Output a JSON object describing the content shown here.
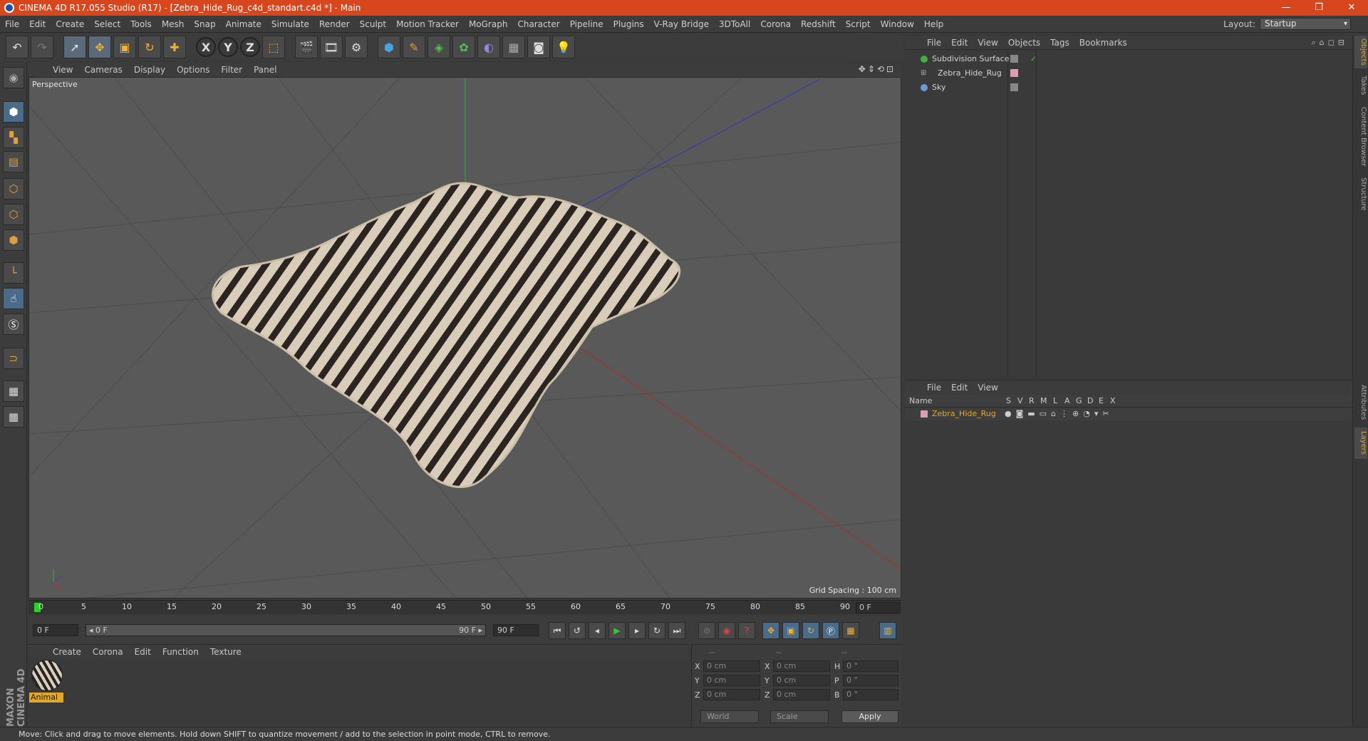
{
  "window": {
    "title": "CINEMA 4D R17.055 Studio (R17) - [Zebra_Hide_Rug_c4d_standart.c4d *] - Main",
    "controls": [
      "—",
      "❐",
      "✕"
    ]
  },
  "menubar": {
    "items": [
      "File",
      "Edit",
      "Create",
      "Select",
      "Tools",
      "Mesh",
      "Snap",
      "Animate",
      "Simulate",
      "Render",
      "Sculpt",
      "Motion Tracker",
      "MoGraph",
      "Character",
      "Pipeline",
      "Plugins",
      "V-Ray Bridge",
      "3DToAll",
      "Corona",
      "Redshift",
      "Script",
      "Window",
      "Help"
    ],
    "layout_label": "Layout:",
    "layout_value": "Startup"
  },
  "toolbar": {
    "icons": [
      "undo-icon",
      "redo-icon",
      "live-selection-icon",
      "move-icon",
      "scale-icon",
      "rotate-icon",
      "create-icon",
      "x-axis-icon",
      "y-axis-icon",
      "z-axis-icon",
      "coordinate-system-icon",
      "render-view-icon",
      "render-picture-viewer-icon",
      "edit-render-settings-icon",
      "cube-icon",
      "pen-icon",
      "subdivision-icon",
      "array-icon",
      "deformer-icon",
      "floor-icon",
      "camera-icon",
      "light-icon"
    ],
    "axis_x": "X",
    "axis_y": "Y",
    "axis_z": "Z"
  },
  "viewport": {
    "menu": [
      "View",
      "Cameras",
      "Display",
      "Options",
      "Filter",
      "Panel"
    ],
    "label": "Perspective",
    "grid_spacing": "Grid Spacing : 100 cm"
  },
  "timeline": {
    "ticks": [
      "0",
      "5",
      "10",
      "15",
      "20",
      "25",
      "30",
      "35",
      "40",
      "45",
      "50",
      "55",
      "60",
      "65",
      "70",
      "75",
      "80",
      "85",
      "90"
    ],
    "current_frame": "0 F"
  },
  "playback": {
    "start_field": "0 F",
    "range_start": "◂ 0 F",
    "range_end": "90 F ▸",
    "end_field": "90 F"
  },
  "material_manager": {
    "menu": [
      "Create",
      "Corona",
      "Edit",
      "Function",
      "Texture"
    ],
    "material_name": "Animal"
  },
  "coordinates": {
    "header": [
      "--",
      "--",
      "--"
    ],
    "rows": [
      {
        "a": "X",
        "av": "0 cm",
        "b": "X",
        "bv": "0 cm",
        "c": "H",
        "cv": "0 °"
      },
      {
        "a": "Y",
        "av": "0 cm",
        "b": "Y",
        "bv": "0 cm",
        "c": "P",
        "cv": "0 °"
      },
      {
        "a": "Z",
        "av": "0 cm",
        "b": "Z",
        "bv": "0 cm",
        "c": "B",
        "cv": "0 °"
      }
    ],
    "mode_world": "World",
    "mode_scale": "Scale",
    "apply": "Apply"
  },
  "object_manager": {
    "menu": [
      "File",
      "Edit",
      "View",
      "Objects",
      "Tags",
      "Bookmarks"
    ],
    "objects": [
      "Subdivision Surface",
      "Zebra_Hide_Rug",
      "Sky"
    ]
  },
  "layer_manager": {
    "menu": [
      "File",
      "Edit",
      "View"
    ],
    "columns": [
      "Name",
      "S",
      "V",
      "R",
      "M",
      "L",
      "A",
      "G",
      "D",
      "E",
      "X"
    ],
    "layer_name": "Zebra_Hide_Rug"
  },
  "side_tabs": [
    "Objects",
    "Takes",
    "Content Browser",
    "Structure",
    "Attributes",
    "Layers"
  ],
  "brand": "MAXON CINEMA 4D",
  "status": "Move: Click and drag to move elements. Hold down SHIFT to quantize movement / add to the selection in point mode, CTRL to remove.",
  "colors": {
    "titlebar": "#d8461d",
    "accent": "#e3a82a",
    "viewport_bg": "#595959"
  }
}
